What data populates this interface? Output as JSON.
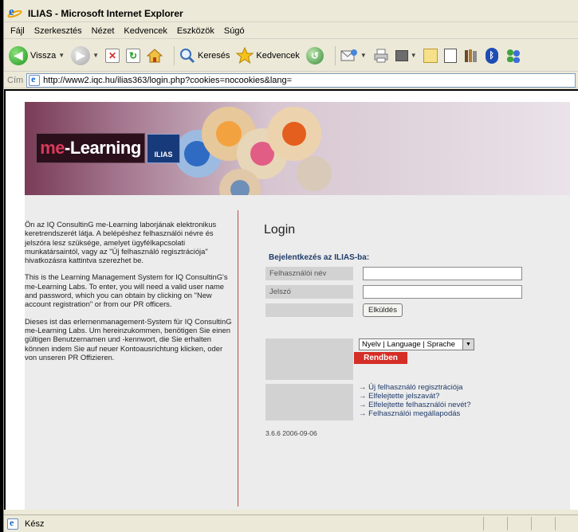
{
  "window": {
    "title": "ILIAS - Microsoft Internet Explorer"
  },
  "menu": [
    "Fájl",
    "Szerkesztés",
    "Nézet",
    "Kedvencek",
    "Eszközök",
    "Súgó"
  ],
  "toolbar": {
    "back_label": "Vissza",
    "search_label": "Keresés",
    "favorites_label": "Kedvencek"
  },
  "address": {
    "label": "Cím",
    "url": "http://www2.iqc.hu/ilias363/login.php?cookies=nocookies&lang="
  },
  "banner": {
    "logo_me": "me",
    "logo_learning": "-Learning",
    "logo_ilias": "ILIAS"
  },
  "intro": [
    "Ön az IQ ConsultinG me-Learning laborjának elektronikus keretrendszerét látja. A belépéshez felhasználói névre és jelszóra lesz szüksége, amelyet ügyfélkapcsolati munkatársaintól, vagy az \"Új felhasználó regisztrációja\" hivatkozásra kattintva szerezhet be.",
    "This is the Learning Management System for IQ ConsultinG's me-Learning Labs. To enter, you will need a valid user name and password, which you can obtain by clicking on \"New account registration\" or from our PR officers.",
    "Dieses ist das erlernenmanagement-System für IQ ConsultinG me-Learning Labs. Um hereinzukommen, benötigen Sie einen gültigen Benutzernamen und -kennwort, die Sie erhalten können indem Sie auf neuer Kontoausrichtung klicken, oder von unseren PR Offizieren."
  ],
  "login": {
    "title": "Login",
    "subtitle": "Bejelentkezés az ILIAS-ba:",
    "username_label": "Felhasználói név",
    "password_label": "Jelszó",
    "username_value": "",
    "password_value": "",
    "submit_label": "Elküldés"
  },
  "language": {
    "selected": "Nyelv | Language | Sprache",
    "ok_label": "Rendben"
  },
  "links": [
    "→ Új felhasználó regisztrációja",
    "→ Elfelejtette jelszavát?",
    "→ Elfelejtette felhasználói nevét?",
    "→ Felhasználói megállapodás"
  ],
  "version": "3.6.6 2006-09-06",
  "status": {
    "text": "Kész"
  }
}
